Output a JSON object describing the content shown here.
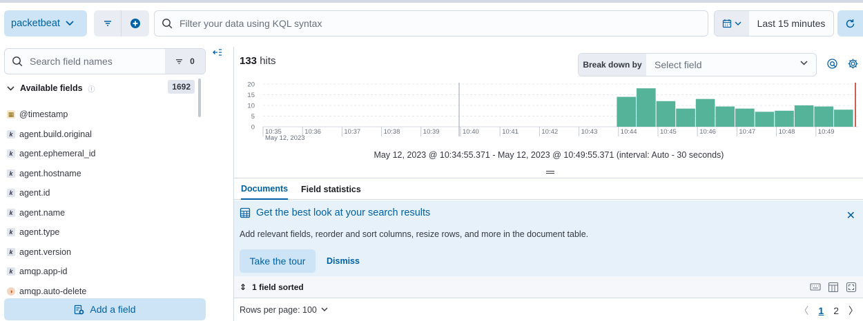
{
  "topbar": {
    "data_view": "packetbeat",
    "query_placeholder": "Filter your data using KQL syntax",
    "time_range": "Last 15 minutes"
  },
  "sidebar": {
    "search_placeholder": "Search field names",
    "filter_count": "0",
    "available_label": "Available fields",
    "available_count": "1692",
    "fields": [
      {
        "type": "date",
        "name": "@timestamp"
      },
      {
        "type": "keyword",
        "name": "agent.build.original"
      },
      {
        "type": "keyword",
        "name": "agent.ephemeral_id"
      },
      {
        "type": "keyword",
        "name": "agent.hostname"
      },
      {
        "type": "keyword",
        "name": "agent.id"
      },
      {
        "type": "keyword",
        "name": "agent.name"
      },
      {
        "type": "keyword",
        "name": "agent.type"
      },
      {
        "type": "keyword",
        "name": "agent.version"
      },
      {
        "type": "keyword",
        "name": "amqp.app-id"
      },
      {
        "type": "boolean",
        "name": "amqp.auto-delete"
      }
    ],
    "add_field": "Add a field"
  },
  "main": {
    "hits_count": "133",
    "hits_label": "hits",
    "breakdown_label": "Break down by",
    "breakdown_placeholder": "Select field",
    "interval_text": "May 12, 2023 @ 10:34:55.371 - May 12, 2023 @ 10:49:55.371 (interval: Auto - 30 seconds)",
    "tabs": [
      "Documents",
      "Field statistics"
    ],
    "callout": {
      "title": "Get the best look at your search results",
      "description": "Add relevant fields, reorder and sort columns, resize rows, and more in the document table.",
      "tour_button": "Take the tour",
      "dismiss": "Dismiss"
    },
    "sort_label": "1 field sorted",
    "rows_per_page": "Rows per page: 100",
    "pages": [
      "1",
      "2"
    ]
  },
  "chart_data": {
    "type": "bar",
    "y_ticks": [
      "20",
      "15",
      "10",
      "5",
      "0"
    ],
    "ylim": [
      0,
      20
    ],
    "x_ticks": [
      "10:35",
      "10:36",
      "10:37",
      "10:38",
      "10:39",
      "10:40",
      "10:41",
      "10:42",
      "10:43",
      "10:44",
      "10:45",
      "10:46",
      "10:47",
      "10:48",
      "10:49"
    ],
    "x_subtitle": "May 12, 2023",
    "bucket_labels": [
      "10:44:00",
      "10:44:30",
      "10:45:00",
      "10:45:30",
      "10:46:00",
      "10:46:30",
      "10:47:00",
      "10:47:30",
      "10:48:00",
      "10:48:30",
      "10:49:00",
      "10:49:30"
    ],
    "values": [
      14,
      18,
      12,
      8.5,
      13,
      9.5,
      8.5,
      7,
      7.5,
      10,
      9.5,
      8
    ],
    "bar_color": "#54b399",
    "grid": true
  }
}
